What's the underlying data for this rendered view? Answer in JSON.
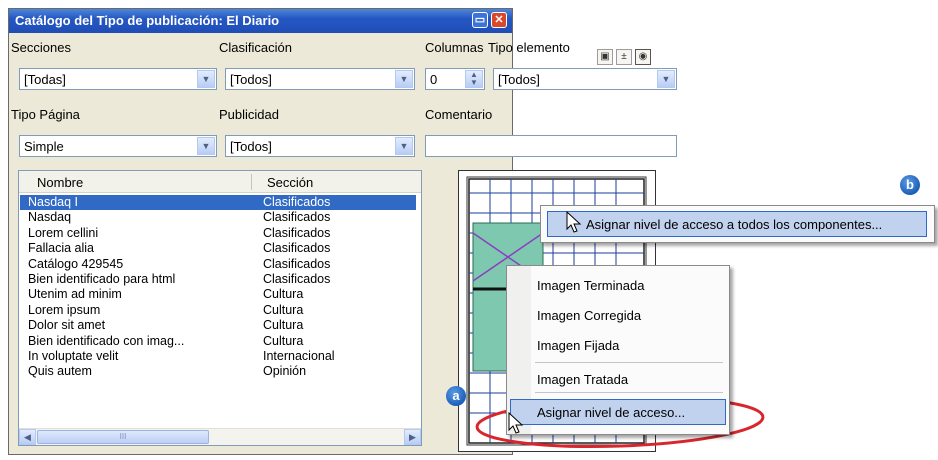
{
  "window": {
    "title": "Catálogo del Tipo de publicación:  El Diario"
  },
  "filters": {
    "secciones_label": "Secciones",
    "secciones_value": "[Todas]",
    "clasificacion_label": "Clasificación",
    "clasificacion_value": "[Todos]",
    "columnas_label": "Columnas",
    "columnas_value": "0",
    "tipo_elemento_label": "Tipo elemento",
    "tipo_elemento_value": "[Todos]",
    "tipo_pagina_label": "Tipo Página",
    "tipo_pagina_value": "Simple",
    "publicidad_label": "Publicidad",
    "publicidad_value": "[Todos]",
    "comentario_label": "Comentario",
    "comentario_value": ""
  },
  "list": {
    "headers": [
      "Nombre",
      "Sección"
    ],
    "rows": [
      {
        "nombre": "Nasdaq I",
        "seccion": "Clasificados"
      },
      {
        "nombre": "Nasdaq",
        "seccion": "Clasificados"
      },
      {
        "nombre": "Lorem cellini",
        "seccion": "Clasificados"
      },
      {
        "nombre": "Fallacia alia",
        "seccion": "Clasificados"
      },
      {
        "nombre": "Catálogo 429545",
        "seccion": "Clasificados"
      },
      {
        "nombre": "Bien identificado para html",
        "seccion": "Clasificados"
      },
      {
        "nombre": "Utenim ad minim",
        "seccion": "Cultura"
      },
      {
        "nombre": "Lorem ipsum",
        "seccion": "Cultura"
      },
      {
        "nombre": "Dolor sit amet",
        "seccion": "Cultura"
      },
      {
        "nombre": "Bien identificado con imag...",
        "seccion": "Cultura"
      },
      {
        "nombre": "In voluptate velit",
        "seccion": "Internacional"
      },
      {
        "nombre": "Quis autem",
        "seccion": "Opinión"
      }
    ],
    "selected_index": 0
  },
  "menu_b": {
    "item": "Asignar nivel de acceso a todos los componentes..."
  },
  "menu_a": {
    "items": [
      "Imagen Terminada",
      "Imagen Corregida",
      "Imagen Fijada",
      "Imagen Tratada"
    ],
    "selected": "Asignar nivel de acceso..."
  },
  "callouts": {
    "a": "a",
    "b": "b"
  },
  "colors": {
    "title_bar": "#2557c4",
    "selection": "#316ac5",
    "menu_highlight": "#c1d2ee",
    "annotation_red": "#d9262c",
    "preview_fill": "#7fc8b0"
  }
}
